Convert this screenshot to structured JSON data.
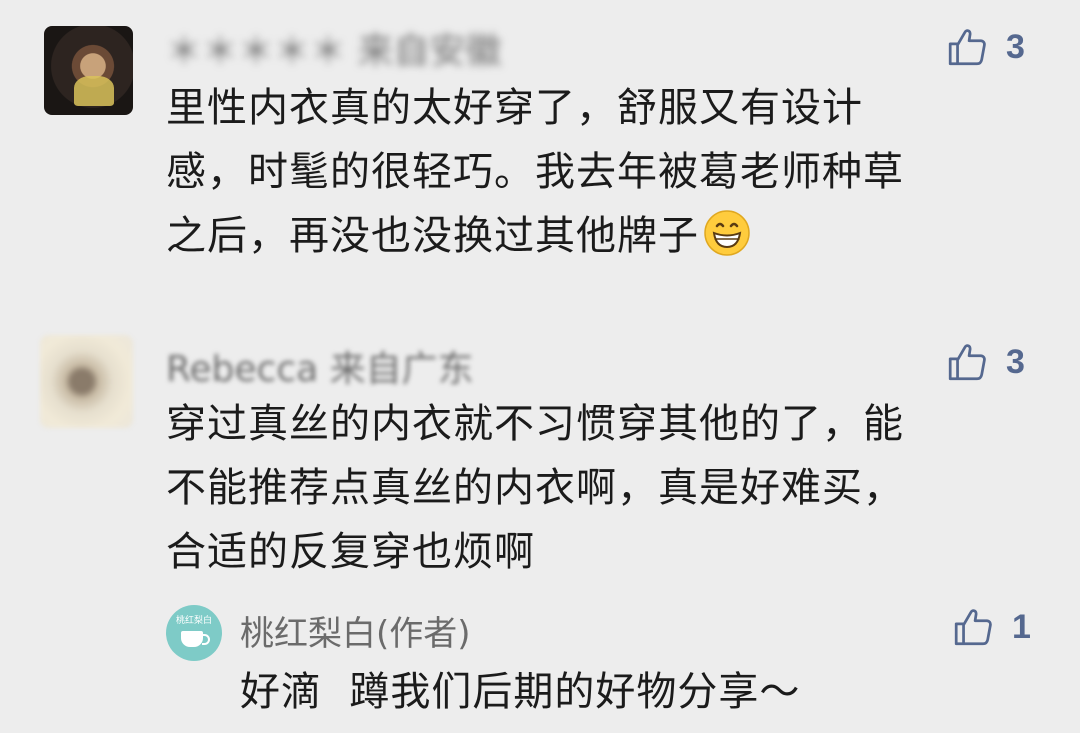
{
  "comments": [
    {
      "username": "＊＊＊＊＊ 来自安徽",
      "text": "里性内衣真的太好穿了，舒服又有设计\n感，时髦的很轻巧。我去年被葛老师种草\n之后，再没也没换过其他牌子",
      "emoji": "grinning-face",
      "likes": "3"
    },
    {
      "username": "Rebecca 来自广东",
      "text": "穿过真丝的内衣就不习惯穿其他的了，能\n不能推荐点真丝的内衣啊，真是好难买，\n合适的反复穿也烦啊",
      "likes": "3"
    }
  ],
  "reply": {
    "avatar_text": "桃红梨白",
    "username": "桃红梨白(作者)",
    "text": "好滴  蹲我们后期的好物分享～",
    "likes": "1"
  },
  "colors": {
    "background": "#ededed",
    "like_blue": "#55688f",
    "text": "#1b1b1b",
    "name_gray": "#6b6b6b"
  }
}
